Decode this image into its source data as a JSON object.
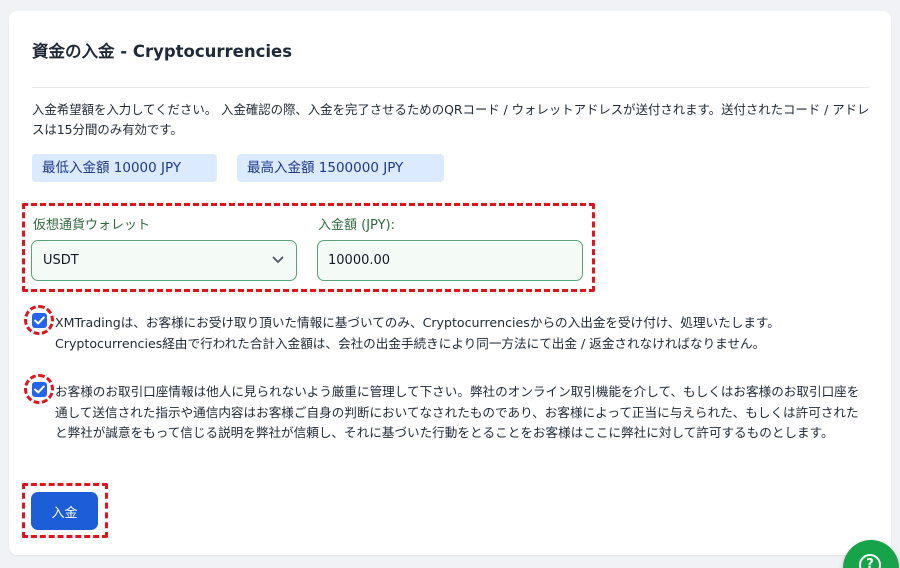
{
  "page": {
    "title": "資金の入金 - Cryptocurrencies",
    "description": "入金希望額を入力してください。 入金確認の際、入金を完了させるためのQRコード / ウォレットアドレスが送付されます。送付されたコード / アドレスは15分間のみ有効です。"
  },
  "limits": {
    "min": "最低入金額 10000 JPY",
    "max": "最高入金額 1500000 JPY"
  },
  "form": {
    "wallet_label": "仮想通貨ウォレット",
    "wallet_value": "USDT",
    "amount_label": "入金額 (JPY):",
    "amount_value": "10000.00"
  },
  "agreements": [
    {
      "checked": true,
      "text": "XMTradingは、お客様にお受け取り頂いた情報に基づいてのみ、Cryptocurrenciesからの入出金を受け付け、処理いたします。Cryptocurrencies経由で行われた合計入金額は、会社の出金手続きにより同一方法にて出金 / 返金されなければなりません。"
    },
    {
      "checked": true,
      "text": "お客様のお取引口座情報は他人に見られないよう厳重に管理して下さい。弊社のオンライン取引機能を介して、もしくはお客様のお取引口座を通して送信された指示や通信内容はお客様ご自身の判断においてなされたものであり、お客様によって正当に与えられた、もしくは許可されたと弊社が誠意をもって信じる説明を弊社が信頼し、それに基づいた行動をとることをお客様はここに弊社に対して許可するものとします。"
    }
  ],
  "submit_label": "入金",
  "help_icon": "?",
  "colors": {
    "accent": "#1d5ed8",
    "highlight": "#e0141e",
    "field_border": "#58a37a",
    "help": "#16a34a"
  }
}
